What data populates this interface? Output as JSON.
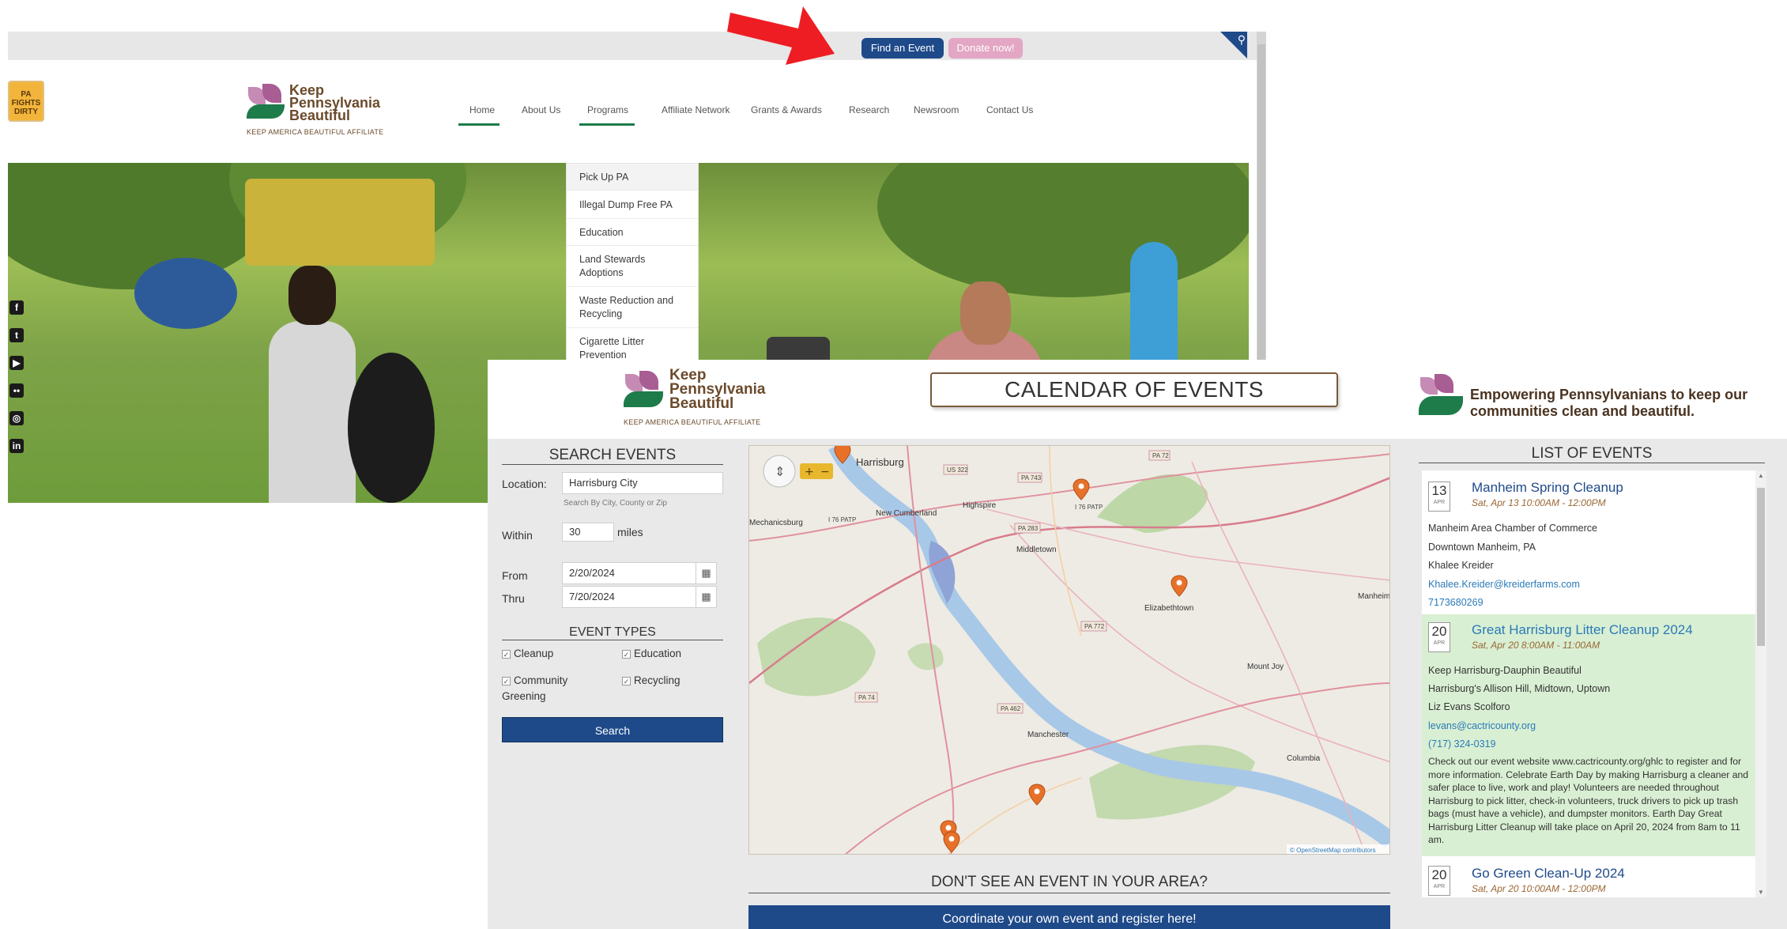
{
  "site": {
    "topbar": {
      "find_event": "Find an Event",
      "donate": "Donate now!"
    },
    "fights_logo": "PA FIGHTS DIRTY",
    "logo": {
      "line1": "Keep",
      "line2": "Pennsylvania",
      "line3": "Beautiful",
      "subtitle": "KEEP AMERICA BEAUTIFUL AFFILIATE"
    },
    "nav": [
      "Home",
      "About Us",
      "Programs",
      "Affiliate Network",
      "Grants & Awards",
      "Research",
      "Newsroom",
      "Contact Us"
    ],
    "programs_menu": [
      "Pick Up PA",
      "Illegal Dump Free PA",
      "Education",
      "Land Stewards Adoptions",
      "Waste Reduction and Recycling",
      "Cigarette Litter Prevention"
    ],
    "social": [
      "facebook-icon",
      "twitter-icon",
      "youtube-icon",
      "flickr-icon",
      "instagram-icon",
      "linkedin-icon"
    ]
  },
  "calendar": {
    "logo": {
      "line1": "Keep",
      "line2": "Pennsylvania",
      "line3": "Beautiful",
      "subtitle": "KEEP AMERICA BEAUTIFUL AFFILIATE"
    },
    "title": "CALENDAR OF EVENTS",
    "tagline": "Empowering Pennsylvanians to keep our communities clean and beautiful.",
    "search": {
      "heading": "SEARCH EVENTS",
      "location_label": "Location:",
      "location_value": "Harrisburg City",
      "location_hint": "Search By City, County or Zip",
      "within_label": "Within",
      "within_value": "30",
      "miles_label": "miles",
      "from_label": "From",
      "from_value": "2/20/2024",
      "thru_label": "Thru",
      "thru_value": "7/20/2024",
      "types_heading": "EVENT TYPES",
      "types": [
        "Cleanup",
        "Education",
        "Community Greening",
        "Recycling"
      ],
      "button": "Search"
    },
    "map": {
      "places": [
        "Harrisburg",
        "New Cumberland",
        "Highspire",
        "Middletown",
        "Elizabethtown",
        "Manheim",
        "Mount Joy",
        "Columbia",
        "Manchester",
        "Mechanicsburg"
      ],
      "roads": [
        "US 322",
        "PA 743",
        "PA 72",
        "I 76 PATP",
        "I 76 PATP",
        "PA 283",
        "PA 772",
        "PA 462",
        "PA 74"
      ],
      "attribution": "© OpenStreetMap contributors"
    },
    "dont_see": "DON'T SEE AN EVENT IN YOUR AREA?",
    "coordinate": "Coordinate your own event and register here!",
    "list_heading": "LIST OF EVENTS",
    "events": [
      {
        "day": "13",
        "month": "APR",
        "title": "Manheim Spring Cleanup",
        "when": "Sat, Apr 13 10:00AM - 12:00PM",
        "org": "Manheim Area Chamber of Commerce",
        "place": "Downtown Manheim, PA",
        "contact": "Khalee Kreider",
        "email": "Khalee.Kreider@kreiderfarms.com",
        "phone": "7173680269"
      },
      {
        "day": "20",
        "month": "APR",
        "title": "Great Harrisburg Litter Cleanup 2024",
        "when": "Sat, Apr 20 8:00AM - 11:00AM",
        "org": "Keep Harrisburg-Dauphin Beautiful",
        "place": "Harrisburg's Allison Hill, Midtown, Uptown",
        "contact": "Liz Evans Scolforo",
        "email": "levans@cactricounty.org",
        "phone": "(717) 324-0319",
        "description": "Check out our event website www.cactricounty.org/ghlc to register and for more information. Celebrate Earth Day by making Harrisburg a cleaner and safer place to live, work and play! Volunteers are needed throughout Harrisburg to pick litter, check-in volunteers, truck drivers to pick up trash bags (must have a vehicle), and dumpster monitors. Earth Day Great Harrisburg Litter Cleanup will take place on April 20, 2024 from 8am to 11 am."
      },
      {
        "day": "20",
        "month": "APR",
        "title": "Go Green Clean-Up 2024",
        "when": "Sat, Apr 20 10:00AM - 12:00PM"
      }
    ]
  }
}
